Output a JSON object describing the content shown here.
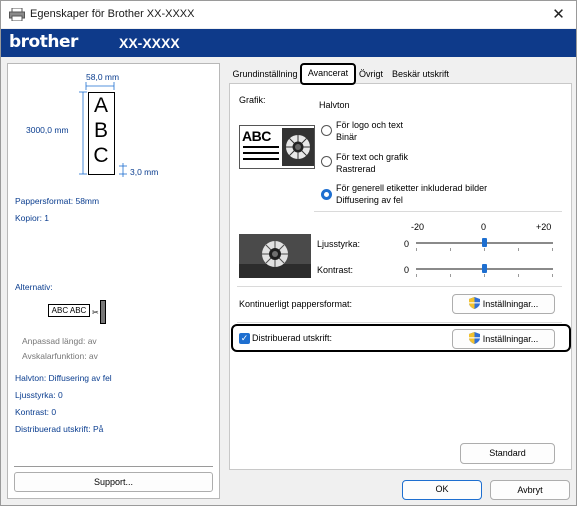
{
  "window": {
    "title": "Egenskaper för Brother XX-XXXX",
    "close_label": "✕"
  },
  "brand": {
    "logo": "brother",
    "model": "XX-XXXX"
  },
  "preview": {
    "width_label": "58,0 mm",
    "length_label": "3000,0 mm",
    "margin_label": "3,0 mm",
    "sample_text": "ABC"
  },
  "summary": {
    "paper_format": "Pappersformat: 58mm",
    "copies": "Kopior: 1",
    "options_label": "Alternativ:",
    "option_sample": "ABC ABC",
    "custom_length": "Anpassad längd: av",
    "cut_function": "Avskalarfunktion: av",
    "halftone": "Halvton: Diffusering av fel",
    "brightness": "Ljusstyrka:   0",
    "contrast": "Kontrast:   0",
    "distributed": "Distribuerad utskrift: På"
  },
  "support_button": "Support...",
  "tabs": [
    {
      "label": "Grundinställning"
    },
    {
      "label": "Avancerat"
    },
    {
      "label": "Övrigt"
    },
    {
      "label": "Beskär utskrift"
    }
  ],
  "graphics": {
    "label": "Grafik:",
    "halftone_label": "Halvton",
    "sample_text": "ABC",
    "options": [
      {
        "title": "För logo och text",
        "sub": "Binär",
        "selected": false
      },
      {
        "title": "För text och grafik",
        "sub": "Rastrerad",
        "selected": false
      },
      {
        "title": "För generell etiketter inkluderad bilder",
        "sub": "Diffusering av fel",
        "selected": true
      }
    ]
  },
  "adjust": {
    "scale_min": "-20",
    "scale_mid": "0",
    "scale_max": "+20",
    "brightness_label": "Ljusstyrka:",
    "brightness_value": "0",
    "contrast_label": "Kontrast:",
    "contrast_value": "0",
    "brightness_level": 0,
    "contrast_level": 0
  },
  "continuous": {
    "label": "Kontinuerligt pappersformat:",
    "button": "Inställningar..."
  },
  "distributed": {
    "label": "Distribuerad utskrift:",
    "checked": true,
    "button": "Inställningar..."
  },
  "standard_button": "Standard",
  "footer": {
    "ok": "OK",
    "cancel": "Avbryt"
  },
  "colors": {
    "brand_bar": "#0e3a8a",
    "accent": "#1e6fd0",
    "summary_text": "#0a3d8f"
  }
}
